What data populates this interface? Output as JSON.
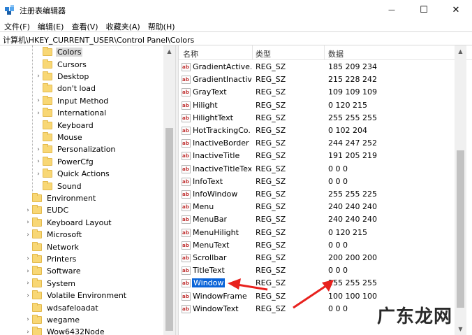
{
  "window": {
    "title": "注册表编辑器",
    "minimize_glyph": "—",
    "maximize_glyph": "☐",
    "close_glyph": "✕"
  },
  "menu": [
    "文件(F)",
    "编辑(E)",
    "查看(V)",
    "收藏夹(A)",
    "帮助(H)"
  ],
  "address": "计算机\\HKEY_CURRENT_USER\\Control Panel\\Colors",
  "tree": {
    "items": [
      {
        "label": "Colors",
        "arrow": "",
        "selected": true,
        "level": 2
      },
      {
        "label": "Cursors",
        "arrow": "",
        "selected": false,
        "level": 2
      },
      {
        "label": "Desktop",
        "arrow": "›",
        "selected": false,
        "level": 2
      },
      {
        "label": "don't load",
        "arrow": "",
        "selected": false,
        "level": 2
      },
      {
        "label": "Input Method",
        "arrow": "›",
        "selected": false,
        "level": 2
      },
      {
        "label": "International",
        "arrow": "›",
        "selected": false,
        "level": 2
      },
      {
        "label": "Keyboard",
        "arrow": "",
        "selected": false,
        "level": 2
      },
      {
        "label": "Mouse",
        "arrow": "",
        "selected": false,
        "level": 2
      },
      {
        "label": "Personalization",
        "arrow": "›",
        "selected": false,
        "level": 2
      },
      {
        "label": "PowerCfg",
        "arrow": "›",
        "selected": false,
        "level": 2
      },
      {
        "label": "Quick Actions",
        "arrow": "›",
        "selected": false,
        "level": 2
      },
      {
        "label": "Sound",
        "arrow": "",
        "selected": false,
        "level": 2
      },
      {
        "label": "Environment",
        "arrow": "",
        "selected": false,
        "level": 1
      },
      {
        "label": "EUDC",
        "arrow": "›",
        "selected": false,
        "level": 1
      },
      {
        "label": "Keyboard Layout",
        "arrow": "›",
        "selected": false,
        "level": 1
      },
      {
        "label": "Microsoft",
        "arrow": "›",
        "selected": false,
        "level": 1
      },
      {
        "label": "Network",
        "arrow": "",
        "selected": false,
        "level": 1
      },
      {
        "label": "Printers",
        "arrow": "›",
        "selected": false,
        "level": 1
      },
      {
        "label": "Software",
        "arrow": "›",
        "selected": false,
        "level": 1
      },
      {
        "label": "System",
        "arrow": "›",
        "selected": false,
        "level": 1
      },
      {
        "label": "Volatile Environment",
        "arrow": "›",
        "selected": false,
        "level": 1
      },
      {
        "label": "wdsafeloadat",
        "arrow": "",
        "selected": false,
        "level": 1
      },
      {
        "label": "wegame",
        "arrow": "›",
        "selected": false,
        "level": 1
      },
      {
        "label": "Wow6432Node",
        "arrow": "›",
        "selected": false,
        "level": 1
      }
    ]
  },
  "list": {
    "headers": {
      "name": "名称",
      "type": "类型",
      "data": "数据"
    },
    "icon_text": "ab",
    "rows": [
      {
        "name": "GradientActive...",
        "type": "REG_SZ",
        "data": "185 209 234",
        "selected": false
      },
      {
        "name": "GradientInactiv...",
        "type": "REG_SZ",
        "data": "215 228 242",
        "selected": false
      },
      {
        "name": "GrayText",
        "type": "REG_SZ",
        "data": "109 109 109",
        "selected": false
      },
      {
        "name": "Hilight",
        "type": "REG_SZ",
        "data": "0 120 215",
        "selected": false
      },
      {
        "name": "HilightText",
        "type": "REG_SZ",
        "data": "255 255 255",
        "selected": false
      },
      {
        "name": "HotTrackingCo...",
        "type": "REG_SZ",
        "data": "0 102 204",
        "selected": false
      },
      {
        "name": "InactiveBorder",
        "type": "REG_SZ",
        "data": "244 247 252",
        "selected": false
      },
      {
        "name": "InactiveTitle",
        "type": "REG_SZ",
        "data": "191 205 219",
        "selected": false
      },
      {
        "name": "InactiveTitleText",
        "type": "REG_SZ",
        "data": "0 0 0",
        "selected": false
      },
      {
        "name": "InfoText",
        "type": "REG_SZ",
        "data": "0 0 0",
        "selected": false
      },
      {
        "name": "InfoWindow",
        "type": "REG_SZ",
        "data": "255 255 225",
        "selected": false
      },
      {
        "name": "Menu",
        "type": "REG_SZ",
        "data": "240 240 240",
        "selected": false
      },
      {
        "name": "MenuBar",
        "type": "REG_SZ",
        "data": "240 240 240",
        "selected": false
      },
      {
        "name": "MenuHilight",
        "type": "REG_SZ",
        "data": "0 120 215",
        "selected": false
      },
      {
        "name": "MenuText",
        "type": "REG_SZ",
        "data": "0 0 0",
        "selected": false
      },
      {
        "name": "Scrollbar",
        "type": "REG_SZ",
        "data": "200 200 200",
        "selected": false
      },
      {
        "name": "TitleText",
        "type": "REG_SZ",
        "data": "0 0 0",
        "selected": false
      },
      {
        "name": "Window",
        "type": "REG_SZ",
        "data": "255 255 255",
        "selected": true
      },
      {
        "name": "WindowFrame",
        "type": "REG_SZ",
        "data": "100 100 100",
        "selected": false
      },
      {
        "name": "WindowText",
        "type": "REG_SZ",
        "data": "0 0 0",
        "selected": false
      }
    ]
  },
  "scroll": {
    "up": "▲",
    "down": "▼"
  },
  "colors": {
    "selection": "#0a64d8",
    "arrow": "#e8211d",
    "folder": "#f8d775"
  },
  "watermark": "广东龙网"
}
